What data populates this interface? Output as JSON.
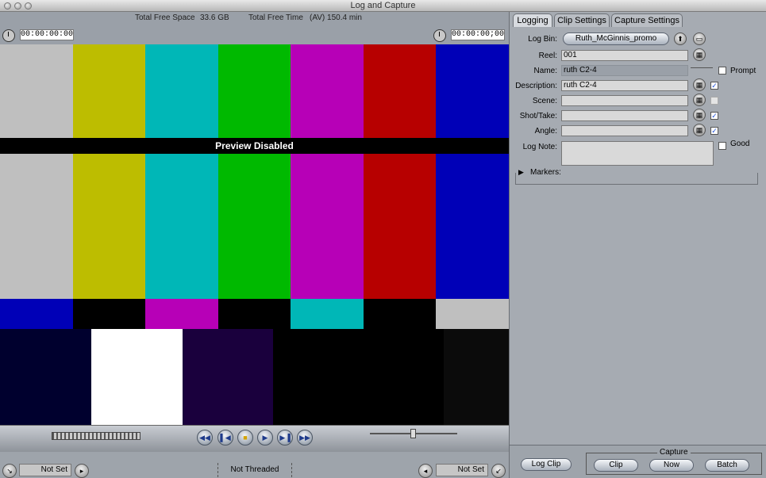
{
  "window": {
    "title": "Log and Capture"
  },
  "viewer": {
    "free_space_label": "Total Free Space",
    "free_space_value": "33.6 GB",
    "free_time_label": "Total Free Time",
    "free_time_value": "(AV) 150.4 min",
    "timecode_left": "00:00:00:00",
    "timecode_right": "00:00:00;00",
    "preview_text": "Preview Disabled",
    "in_point": "Not Set",
    "out_point": "Not Set",
    "threading": "Not Threaded"
  },
  "tabs": [
    "Logging",
    "Clip Settings",
    "Capture Settings"
  ],
  "logging": {
    "log_bin_label": "Log Bin:",
    "log_bin_value": "Ruth_McGinnis_promo",
    "reel_label": "Reel:",
    "reel_value": "001",
    "name_label": "Name:",
    "name_value": "ruth C2-4",
    "prompt_label": "Prompt",
    "description_label": "Description:",
    "description_value": "ruth C2-4",
    "scene_label": "Scene:",
    "scene_value": "",
    "shot_label": "Shot/Take:",
    "shot_value": "",
    "angle_label": "Angle:",
    "angle_value": "",
    "log_note_label": "Log Note:",
    "log_note_value": "",
    "good_label": "Good",
    "markers_label": "Markers:",
    "checks": {
      "description": true,
      "scene": false,
      "shot": true,
      "angle": true,
      "prompt": false,
      "good": false
    }
  },
  "capture": {
    "log_clip": "Log Clip",
    "group_label": "Capture",
    "clip": "Clip",
    "now": "Now",
    "batch": "Batch"
  },
  "icons": {
    "transport": [
      "rewind-icon",
      "step-back-icon",
      "stop-icon",
      "play-icon",
      "step-forward-icon",
      "fast-forward-icon"
    ],
    "slate": "slate-icon",
    "folder": "folder-icon",
    "timecode": "clock-icon"
  },
  "colors": {
    "bar_colors": [
      "#bfbfbf",
      "#bdbd00",
      "#00b7b7",
      "#00b900",
      "#b700b7",
      "#b70000",
      "#0000b7"
    ],
    "reverse_colors": [
      "#0000b7",
      "#000000",
      "#b700b7",
      "#000000",
      "#00b7b7",
      "#000000",
      "#bfbfbf"
    ],
    "pluge_colors": [
      "#00002e",
      "#ffffff",
      "#1a003d",
      "#000000",
      "#000000",
      "#0b0b0b",
      "#000000"
    ]
  }
}
